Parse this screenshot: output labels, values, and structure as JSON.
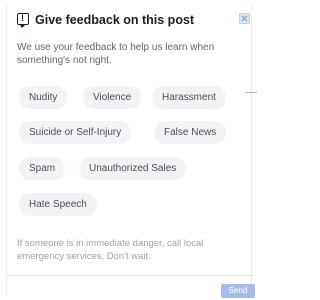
{
  "dialog": {
    "title": "Give feedback on this post",
    "intro": "We use your feedback to help us learn when something's not right.",
    "options": [
      "Nudity",
      "Violence",
      "Harassment",
      "Suicide or Self-Injury",
      "False News",
      "Spam",
      "Unauthorized Sales",
      "Hate Speech"
    ],
    "hint": "If someone is in immediate danger, call local emergency services. Don't wait.",
    "send_label": "Send"
  },
  "colors": {
    "pill_bg": "#f2f3f5",
    "send_bg": "#a9bbe8",
    "title_text": "#1c1e21"
  },
  "icons": {
    "header": "report-flag-icon",
    "close": "close-icon"
  }
}
